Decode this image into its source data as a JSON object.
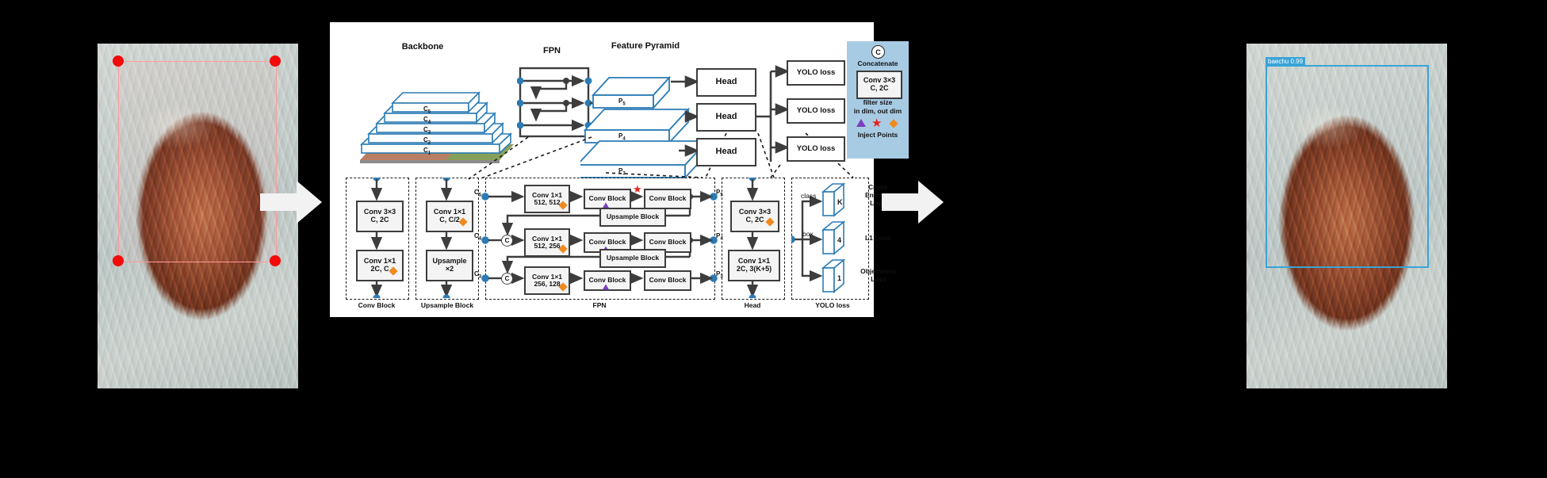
{
  "figure": {
    "pipeline_arrows": [
      "right-arrow-1",
      "right-arrow-2"
    ]
  },
  "input_photo": {
    "name": "kimchi-input-photo",
    "annotation_type": "bounding-box-with-corner-points",
    "corner_points": 4,
    "box_color": "#ff9a9a",
    "point_color": "#f30b0b"
  },
  "output_photo": {
    "name": "kimchi-detection-photo",
    "detection_label": "baechu 0.99",
    "box_color": "#3aa3d6"
  },
  "diagram": {
    "sections": {
      "backbone_title": "Backbone",
      "fpn_title": "FPN",
      "feature_pyramid_title": "Feature Pyramid"
    },
    "backbone_layers": [
      "C5",
      "C4",
      "C3",
      "C2",
      "C1"
    ],
    "backbone_layers_sub": [
      "5",
      "4",
      "3",
      "2",
      "1"
    ],
    "feature_pyramid_layers": [
      "P5",
      "P4",
      "P3"
    ],
    "feature_pyramid_sub": [
      "5",
      "4",
      "3"
    ],
    "heads": [
      "Head",
      "Head",
      "Head"
    ],
    "yolo_losses": [
      "YOLO loss",
      "YOLO loss",
      "YOLO loss"
    ],
    "legend": {
      "concat_icon": "C",
      "concat_label": "Concatenate",
      "conv_example_line1": "Conv 3×3",
      "conv_example_line2": "C, 2C",
      "conv_caption_line1": "filter size",
      "conv_caption_line2": "in dim, out dim",
      "inject_label": "Inject Points",
      "colors": {
        "panel": "#a8cbe4",
        "triangle": "#7b3fbf",
        "star": "#e8221b",
        "diamond": "#f08a20",
        "slab_outline": "#2b7cb5",
        "node": "#2b7cb5",
        "wire": "#3d3d3d"
      }
    },
    "conv_block_detail": {
      "caption": "Conv Block",
      "blocks": [
        {
          "line1": "Conv 3×3",
          "line2": "C, 2C",
          "marker": "none"
        },
        {
          "line1": "Conv 1×1",
          "line2": "2C, C",
          "marker": "diamond"
        }
      ]
    },
    "upsample_block_detail": {
      "caption": "Upsample Block",
      "blocks": [
        {
          "line1": "Conv 1×1",
          "line2": "C, C/2",
          "marker": "diamond"
        },
        {
          "line1": "Upsample",
          "line2": "×2",
          "marker": "none"
        }
      ]
    },
    "fpn_detail": {
      "caption": "FPN",
      "inputs": [
        "C5",
        "C4",
        "C3"
      ],
      "inputs_sub": [
        "5",
        "4",
        "3"
      ],
      "outputs": [
        "P5",
        "P4",
        "P3"
      ],
      "outputs_sub": [
        "5",
        "4",
        "3"
      ],
      "rows": [
        {
          "conv_line1": "Conv 1×1",
          "conv_line2": "512, 512",
          "conv_marker": "diamond",
          "block_a": "Conv Block",
          "block_a_marker": "triangle",
          "between_marker": "star",
          "block_b": "Conv Block",
          "concat": false
        },
        {
          "conv_line1": "Conv 1×1",
          "conv_line2": "512, 256",
          "conv_marker": "diamond",
          "block_a": "Conv Block",
          "block_a_marker": "triangle",
          "between_marker": "none",
          "block_b": "Conv Block",
          "concat": true
        },
        {
          "conv_line1": "Conv 1×1",
          "conv_line2": "256, 128",
          "conv_marker": "diamond",
          "block_a": "Conv Block",
          "block_a_marker": "triangle",
          "between_marker": "none",
          "block_b": "Conv Block",
          "concat": true
        }
      ],
      "upsample_blocks": [
        "Upsample Block",
        "Upsample Block"
      ]
    },
    "head_detail": {
      "caption": "Head",
      "blocks": [
        {
          "line1": "Conv 3×3",
          "line2": "C, 2C",
          "marker": "diamond"
        },
        {
          "line1": "Conv 1×1",
          "line2": "2C, 3(K+5)",
          "marker": "none"
        }
      ]
    },
    "yolo_loss_detail": {
      "caption": "YOLO loss",
      "branch_labels": [
        "class",
        "box"
      ],
      "plates": [
        {
          "value": "K",
          "loss_line1": "Cross",
          "loss_line2": "Entropy",
          "loss_line3": "Loss"
        },
        {
          "value": "4",
          "loss_line1": "L1 Loss",
          "loss_line2": "",
          "loss_line3": ""
        },
        {
          "value": "1",
          "loss_line1": "Objectness",
          "loss_line2": "Loss",
          "loss_line3": ""
        }
      ]
    }
  }
}
